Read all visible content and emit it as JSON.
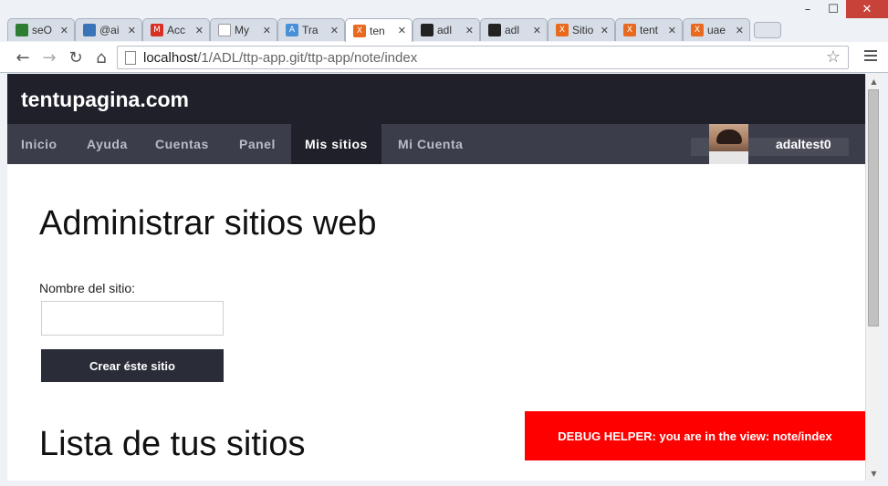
{
  "window": {
    "minimize": "–",
    "maximize": "☐",
    "close": "✕"
  },
  "tabs": [
    {
      "label": "seO",
      "color": "#2e7d32",
      "glyph": ""
    },
    {
      "label": "@ai",
      "color": "#3b73b9",
      "glyph": ""
    },
    {
      "label": "Acc",
      "color": "#d93025",
      "glyph": "M"
    },
    {
      "label": "My",
      "color": "#ffffff",
      "glyph": ""
    },
    {
      "label": "Tra",
      "color": "#4a90d9",
      "glyph": "A"
    },
    {
      "label": "ten",
      "color": "#e86a1f",
      "glyph": "X",
      "active": true
    },
    {
      "label": "adl",
      "color": "#222222",
      "glyph": ""
    },
    {
      "label": "adl",
      "color": "#222222",
      "glyph": ""
    },
    {
      "label": "Sitio",
      "color": "#e86a1f",
      "glyph": "X"
    },
    {
      "label": "tent",
      "color": "#e86a1f",
      "glyph": "X"
    },
    {
      "label": "uae",
      "color": "#e86a1f",
      "glyph": "X"
    }
  ],
  "toolbar": {
    "back": "←",
    "forward": "→",
    "reload": "↻",
    "home": "⌂",
    "url_host": "localhost",
    "url_path": "/1/ADL/ttp-app.git/ttp-app/note/index",
    "star": "☆"
  },
  "site": {
    "brand": "tentupagina.com",
    "nav": [
      {
        "label": "Inicio"
      },
      {
        "label": "Ayuda"
      },
      {
        "label": "Cuentas"
      },
      {
        "label": "Panel"
      },
      {
        "label": "Mis sitios",
        "active": true
      },
      {
        "label": "Mi Cuenta"
      }
    ],
    "username": "adaltest0"
  },
  "main": {
    "title": "Administrar sitios web",
    "field_label": "Nombre del sitio:",
    "field_value": "",
    "create_button": "Crear éste sitio",
    "list_title": "Lista de tus sitios"
  },
  "debug": {
    "text": "DEBUG HELPER: you are in the view: note/index"
  },
  "colors": {
    "header": "#1f2029",
    "nav": "#3b3d4a",
    "button": "#2a2c38",
    "debug": "#ff0000"
  }
}
